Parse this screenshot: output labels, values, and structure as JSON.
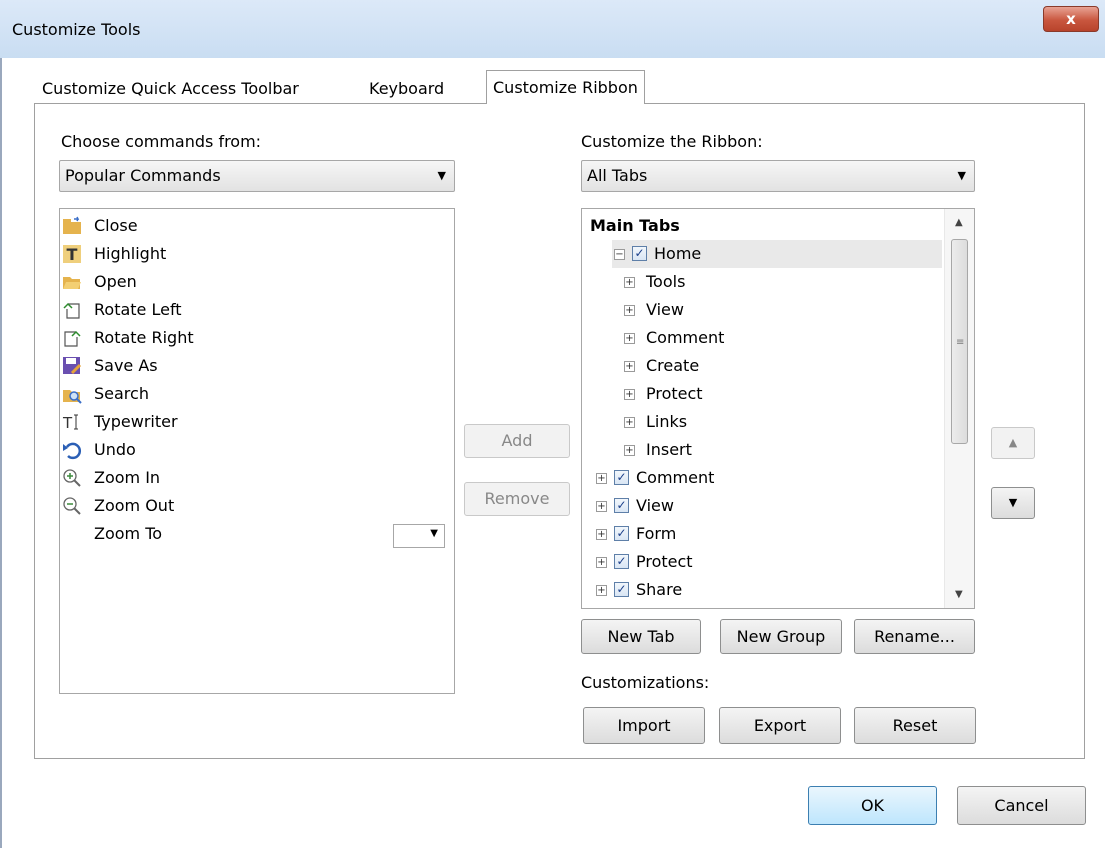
{
  "window": {
    "title": "Customize Tools",
    "close_label": "x"
  },
  "tabs": [
    {
      "label": "Customize Quick Access Toolbar"
    },
    {
      "label": "Keyboard"
    },
    {
      "label": "Customize Ribbon"
    }
  ],
  "left": {
    "label": "Choose commands from:",
    "combo_value": "Popular Commands",
    "commands": [
      {
        "label": "Close",
        "icon": "folder-close-icon"
      },
      {
        "label": "Highlight",
        "icon": "highlight-text-icon"
      },
      {
        "label": "Open",
        "icon": "open-folder-icon"
      },
      {
        "label": "Rotate Left",
        "icon": "rotate-left-icon"
      },
      {
        "label": "Rotate Right",
        "icon": "rotate-right-icon"
      },
      {
        "label": "Save As",
        "icon": "save-as-icon"
      },
      {
        "label": "Search",
        "icon": "search-folder-icon"
      },
      {
        "label": "Typewriter",
        "icon": "typewriter-icon"
      },
      {
        "label": "Undo",
        "icon": "undo-icon"
      },
      {
        "label": "Zoom In",
        "icon": "zoom-in-icon"
      },
      {
        "label": "Zoom Out",
        "icon": "zoom-out-icon"
      },
      {
        "label": "Zoom To",
        "icon": ""
      }
    ]
  },
  "middle": {
    "add_label": "Add",
    "remove_label": "Remove"
  },
  "right": {
    "label": "Customize the Ribbon:",
    "combo_value": "All Tabs",
    "tree_header": "Main Tabs",
    "tree": [
      {
        "label": "Home",
        "expander": "−",
        "checked": true
      },
      {
        "label": "Tools",
        "expander": "+"
      },
      {
        "label": "View",
        "expander": "+"
      },
      {
        "label": "Comment",
        "expander": "+"
      },
      {
        "label": "Create",
        "expander": "+"
      },
      {
        "label": "Protect",
        "expander": "+"
      },
      {
        "label": "Links",
        "expander": "+"
      },
      {
        "label": "Insert",
        "expander": "+"
      },
      {
        "label": "Comment",
        "expander": "+",
        "checked": true
      },
      {
        "label": "View",
        "expander": "+",
        "checked": true
      },
      {
        "label": "Form",
        "expander": "+",
        "checked": true
      },
      {
        "label": "Protect",
        "expander": "+",
        "checked": true
      },
      {
        "label": "Share",
        "expander": "+",
        "checked": true
      }
    ],
    "new_tab_label": "New Tab",
    "new_group_label": "New Group",
    "rename_label": "Rename...",
    "customizations_label": "Customizations:",
    "import_label": "Import",
    "export_label": "Export",
    "reset_label": "Reset"
  },
  "footer": {
    "ok_label": "OK",
    "cancel_label": "Cancel"
  },
  "colors": {
    "titlebar": "#dce9f8",
    "close": "#c9573f",
    "ok_border": "#3c7fb1"
  }
}
